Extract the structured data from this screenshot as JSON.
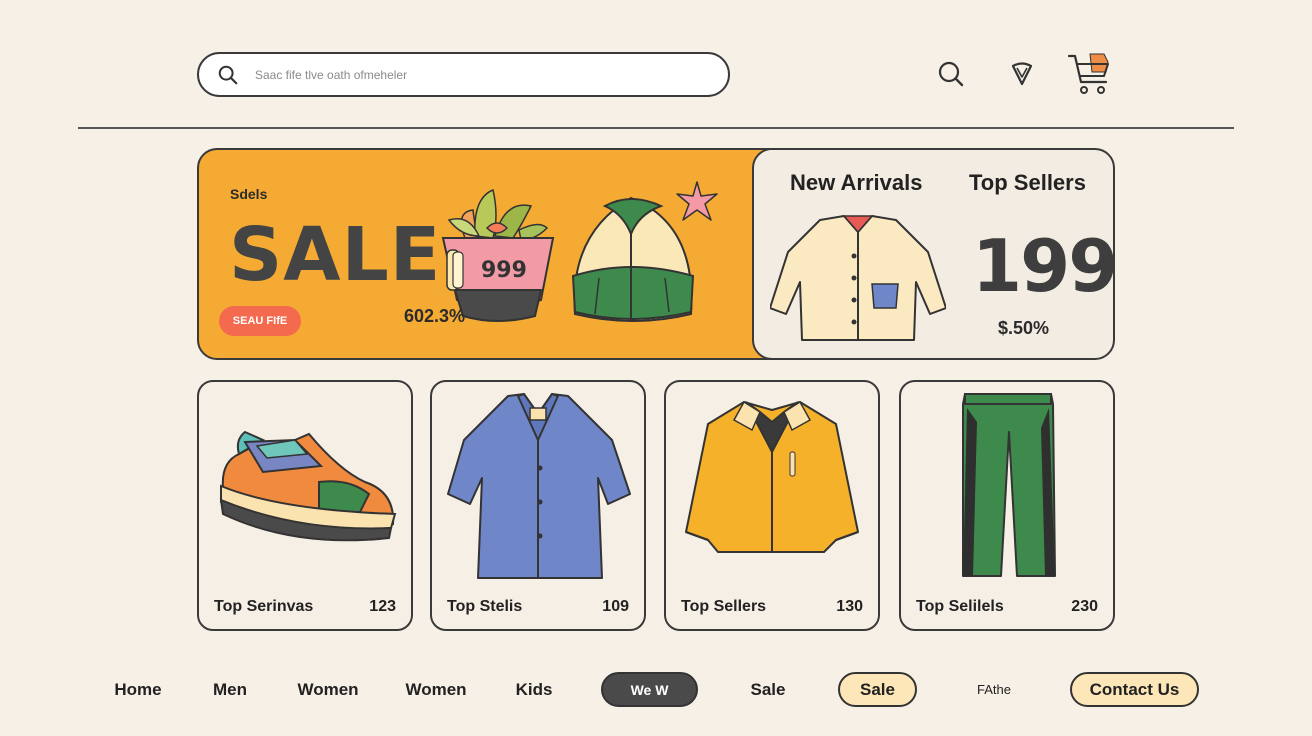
{
  "search": {
    "placeholder": "Saac fife tlve oath ofmeheler"
  },
  "header_icons": [
    "search-icon",
    "heart-icon",
    "cart-icon"
  ],
  "hero": {
    "small_label": "Sdels",
    "headline": "SALE",
    "button_label": "SEAU FIfE",
    "price_tag": "999",
    "percent": "602.3%"
  },
  "feature": {
    "tabs": [
      "New Arrivals",
      "Top Sellers"
    ],
    "big_number": "199",
    "percent": "$.50%"
  },
  "products": [
    {
      "name": "Top Serinvas",
      "value": "123",
      "icon": "sneaker-icon"
    },
    {
      "name": "Top Stelis",
      "value": "109",
      "icon": "shirt-icon"
    },
    {
      "name": "Top Sellers",
      "value": "130",
      "icon": "jacket-icon"
    },
    {
      "name": "Top Selilels",
      "value": "230",
      "icon": "pants-icon"
    }
  ],
  "nav": [
    "Home",
    "Men",
    "Women",
    "Women",
    "Kids",
    "We W",
    "Sale",
    "Sale",
    "FAthe",
    "Contact Us"
  ],
  "colors": {
    "background": "#f7f0e7",
    "accent_orange": "#f5ab33",
    "sale_button": "#f46a4e",
    "pill_dark": "#4a4a4a",
    "pill_light": "#fde7b8"
  }
}
